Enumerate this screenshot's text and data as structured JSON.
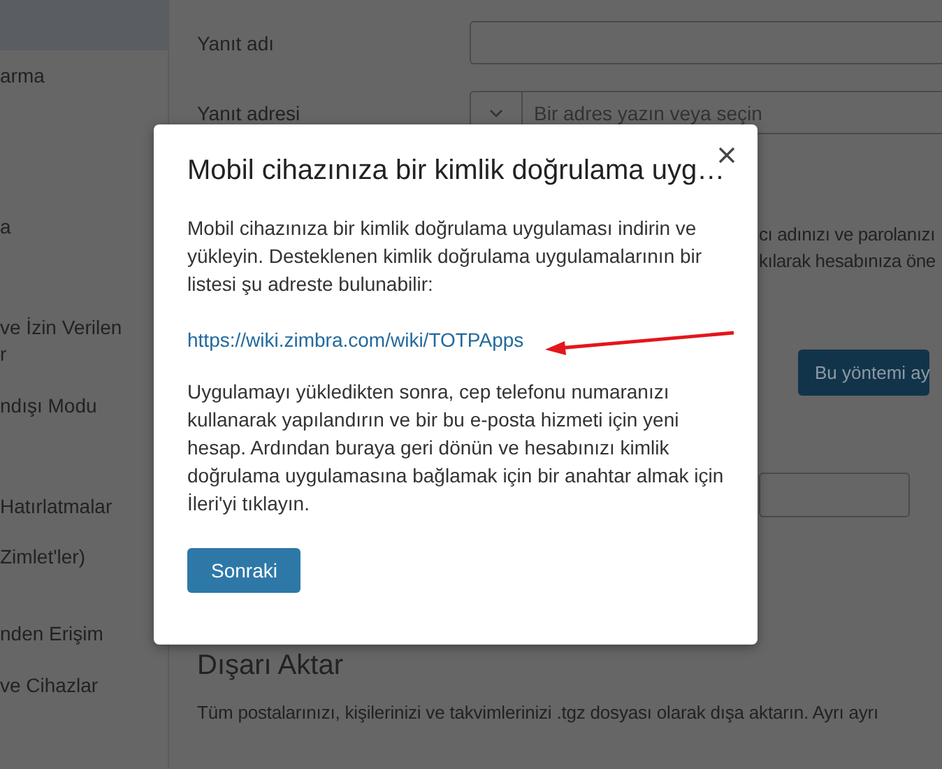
{
  "sidebar": {
    "items": [
      {
        "lines": [
          "arma"
        ]
      },
      {
        "lines": [
          "a"
        ]
      },
      {
        "lines": [
          "ve İzin Verilen",
          "r"
        ]
      },
      {
        "lines": [
          "ndışı Modu"
        ]
      },
      {
        "lines": [
          "Hatırlatmalar"
        ]
      },
      {
        "lines": [
          "Zimlet'ler)"
        ]
      },
      {
        "lines": [
          "nden Erişim"
        ]
      },
      {
        "lines": [
          "ve Cihazlar"
        ]
      }
    ]
  },
  "form": {
    "reply_name_label": "Yanıt adı",
    "reply_address_label": "Yanıt adresi",
    "reply_address_placeholder": "Bir adres yazın veya seçin"
  },
  "auth_section": {
    "text_lines": [
      "cı adınızı ve parolanızı",
      "kılarak hesabınıza öne"
    ],
    "setup_button": "Bu yöntemi ay"
  },
  "export_section": {
    "title": "Dışarı Aktar",
    "text": "Tüm postalarınızı, kişilerinizi ve takvimlerinizi .tgz dosyası olarak dışa aktarın. Ayrı ayrı"
  },
  "dialog": {
    "title": "Mobil cihazınıza bir kimlik doğrulama uyg…",
    "intro": "Mobil cihazınıza bir kimlik doğrulama uygulaması indirin ve yükleyin. Desteklenen kimlik doğrulama uygulamalarının bir listesi şu adreste bulunabilir:",
    "link": "https://wiki.zimbra.com/wiki/TOTPApps",
    "instructions": "Uygulamayı yükledikten sonra, cep telefonu numaranızı kullanarak yapılandırın ve bir bu e-posta hizmeti için yeni hesap. Ardından buraya geri dönün ve hesabınızı kimlik doğrulama uygulamasına bağlamak için bir anahtar almak için İleri'yi tıklayın.",
    "next_button": "Sonraki"
  }
}
